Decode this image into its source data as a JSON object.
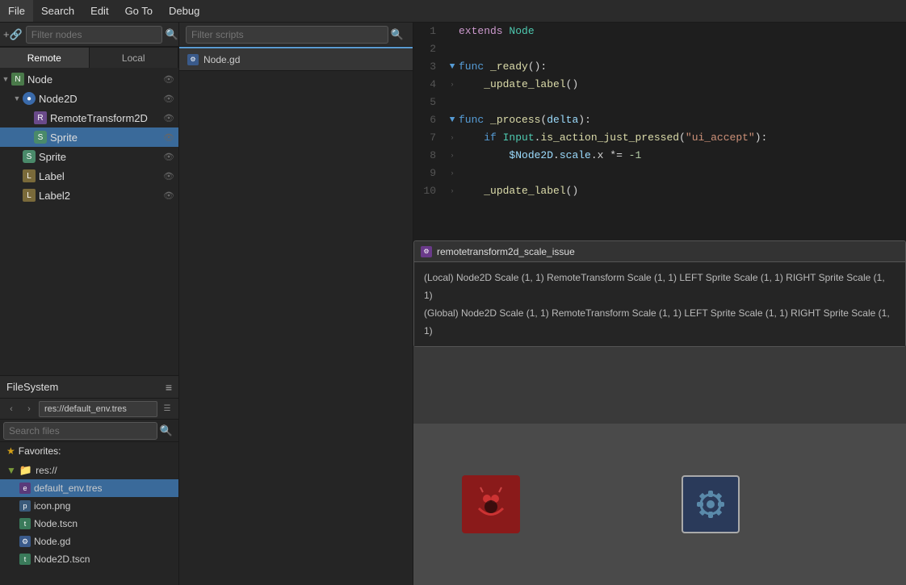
{
  "menubar": {
    "items": [
      "File",
      "Search",
      "Edit",
      "Go To",
      "Debug"
    ]
  },
  "filter_nodes": {
    "placeholder": "Filter nodes"
  },
  "scene_tree": {
    "items": [
      {
        "id": "node",
        "label": "Node",
        "level": 0,
        "type": "node",
        "has_arrow": true,
        "expanded": true,
        "has_eye": true
      },
      {
        "id": "node2d",
        "label": "Node2D",
        "level": 1,
        "type": "node2d",
        "has_arrow": true,
        "expanded": true,
        "has_eye": true
      },
      {
        "id": "remotetransform2d",
        "label": "RemoteTransform2D",
        "level": 2,
        "type": "remote",
        "has_arrow": false,
        "expanded": false,
        "has_eye": true
      },
      {
        "id": "sprite1",
        "label": "Sprite",
        "level": 2,
        "type": "sprite",
        "has_arrow": false,
        "expanded": false,
        "has_eye": true,
        "selected": true
      },
      {
        "id": "sprite2",
        "label": "Sprite",
        "level": 1,
        "type": "sprite",
        "has_arrow": false,
        "expanded": false,
        "has_eye": true
      },
      {
        "id": "label1",
        "label": "Label",
        "level": 1,
        "type": "label",
        "has_arrow": false,
        "expanded": false,
        "has_eye": true
      },
      {
        "id": "label2",
        "label": "Label2",
        "level": 1,
        "type": "label",
        "has_arrow": false,
        "expanded": false,
        "has_eye": true
      }
    ]
  },
  "remote_local": {
    "remote_label": "Remote",
    "local_label": "Local",
    "active": "remote"
  },
  "filesystem": {
    "title": "FileSystem",
    "menu_icon": "≡",
    "back_icon": "‹",
    "forward_icon": "›",
    "path": "res://default_env.tres",
    "layout_icon": "☰",
    "search_placeholder": "Search files",
    "favorites_label": "Favorites:",
    "tree": {
      "root": "res://",
      "files": [
        {
          "id": "default_env",
          "label": "default_env.tres",
          "type": "env",
          "selected": true
        },
        {
          "id": "icon_png",
          "label": "icon.png",
          "type": "png"
        },
        {
          "id": "node_tscn",
          "label": "Node.tscn",
          "type": "tscn"
        },
        {
          "id": "node_gd",
          "label": "Node.gd",
          "type": "gd"
        },
        {
          "id": "node2d_tscn",
          "label": "Node2D.tscn",
          "type": "tscn"
        }
      ]
    }
  },
  "scripts": {
    "filter_placeholder": "Filter scripts",
    "tabs": [
      {
        "id": "node_gd",
        "label": "Node.gd",
        "active": true
      }
    ]
  },
  "code_editor": {
    "lines": [
      {
        "num": 1,
        "indent": 0,
        "tokens": [
          {
            "text": "extends ",
            "class": "kw-extends"
          },
          {
            "text": "Node",
            "class": "class-name"
          }
        ]
      },
      {
        "num": 2,
        "indent": 0,
        "tokens": []
      },
      {
        "num": 3,
        "indent": 0,
        "tokens": [
          {
            "text": "func ",
            "class": "kw-func"
          },
          {
            "text": "_ready",
            "class": "fn-name"
          },
          {
            "text": "():",
            "class": "op"
          }
        ],
        "has_arrow": true
      },
      {
        "num": 4,
        "indent": 1,
        "tokens": [
          {
            "text": "_update_label",
            "class": "fn-name"
          },
          {
            "text": "()",
            "class": "op"
          }
        ]
      },
      {
        "num": 5,
        "indent": 0,
        "tokens": []
      },
      {
        "num": 6,
        "indent": 0,
        "tokens": [
          {
            "text": "func ",
            "class": "kw-func"
          },
          {
            "text": "_process",
            "class": "fn-name"
          },
          {
            "text": "(",
            "class": "op"
          },
          {
            "text": "delta",
            "class": "var-name"
          },
          {
            "text": "):",
            "class": "op"
          }
        ],
        "has_arrow": true
      },
      {
        "num": 7,
        "indent": 1,
        "tokens": [
          {
            "text": "if ",
            "class": "kw-if"
          },
          {
            "text": "Input",
            "class": "class-name"
          },
          {
            "text": ".",
            "class": "op"
          },
          {
            "text": "is_action_just_pressed",
            "class": "fn-name"
          },
          {
            "text": "(",
            "class": "op"
          },
          {
            "text": "\"ui_accept\"",
            "class": "str-val"
          },
          {
            "text": "):",
            "class": "op"
          }
        ]
      },
      {
        "num": 8,
        "indent": 2,
        "tokens": [
          {
            "text": "$Node2D",
            "class": "var-name"
          },
          {
            "text": ".",
            "class": "op"
          },
          {
            "text": "scale",
            "class": "var-name"
          },
          {
            "text": ".x *= ",
            "class": "op"
          },
          {
            "text": "-1",
            "class": "num"
          }
        ]
      },
      {
        "num": 9,
        "indent": 1,
        "tokens": []
      },
      {
        "num": 10,
        "indent": 1,
        "tokens": [
          {
            "text": "_update_label",
            "class": "fn-name"
          },
          {
            "text": "()",
            "class": "op"
          }
        ]
      }
    ]
  },
  "popup": {
    "icon": "🔧",
    "title": "remotetransform2d_scale_issue",
    "lines": [
      "(Local) Node2D Scale (1, 1) RemoteTransform Scale (1, 1) LEFT Sprite Scale (1, 1) RIGHT Sprite Scale (1, 1)",
      "(Global) Node2D Scale (1, 1) RemoteTransform Scale (1, 1) LEFT Sprite Scale (1, 1) RIGHT Sprite Scale (1, 1)"
    ]
  },
  "viewport": {
    "sprite_left_char": "👾",
    "sprite_right_char": "⚙"
  }
}
